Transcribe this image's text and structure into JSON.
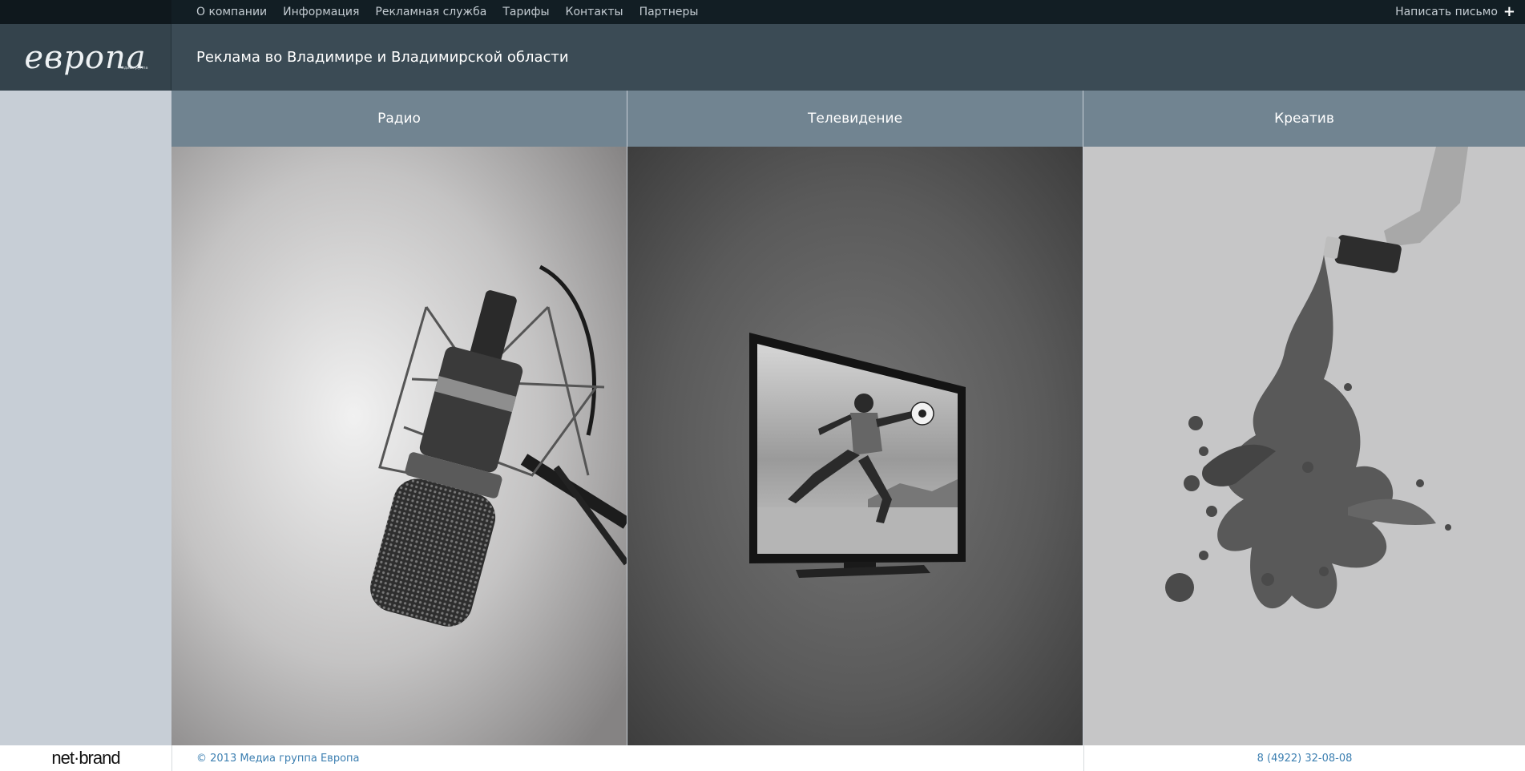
{
  "nav": {
    "items": [
      "О компании",
      "Информация",
      "Рекламная служба",
      "Тарифы",
      "Контакты",
      "Партнеры"
    ],
    "write_label": "Написать письмо",
    "write_icon": "plus-icon"
  },
  "header": {
    "logo": "европа",
    "logo_sub": "медиа группа",
    "title": "Реклама во Владимире и Владимирской области"
  },
  "sections": [
    {
      "label": "Радио",
      "image": "microphone"
    },
    {
      "label": "Телевидение",
      "image": "tv-football-player"
    },
    {
      "label": "Креатив",
      "image": "paint-splash"
    }
  ],
  "footer": {
    "brand": "net·brand",
    "copyright": "© 2013 Медиа группа Европа",
    "phone": "8 (4922) 32-08-08"
  },
  "colors": {
    "topbar": "#121e24",
    "header": "#3b4b55",
    "section_head": "#718491",
    "sidebar": "#c7ced6",
    "link": "#3c7fb1"
  }
}
